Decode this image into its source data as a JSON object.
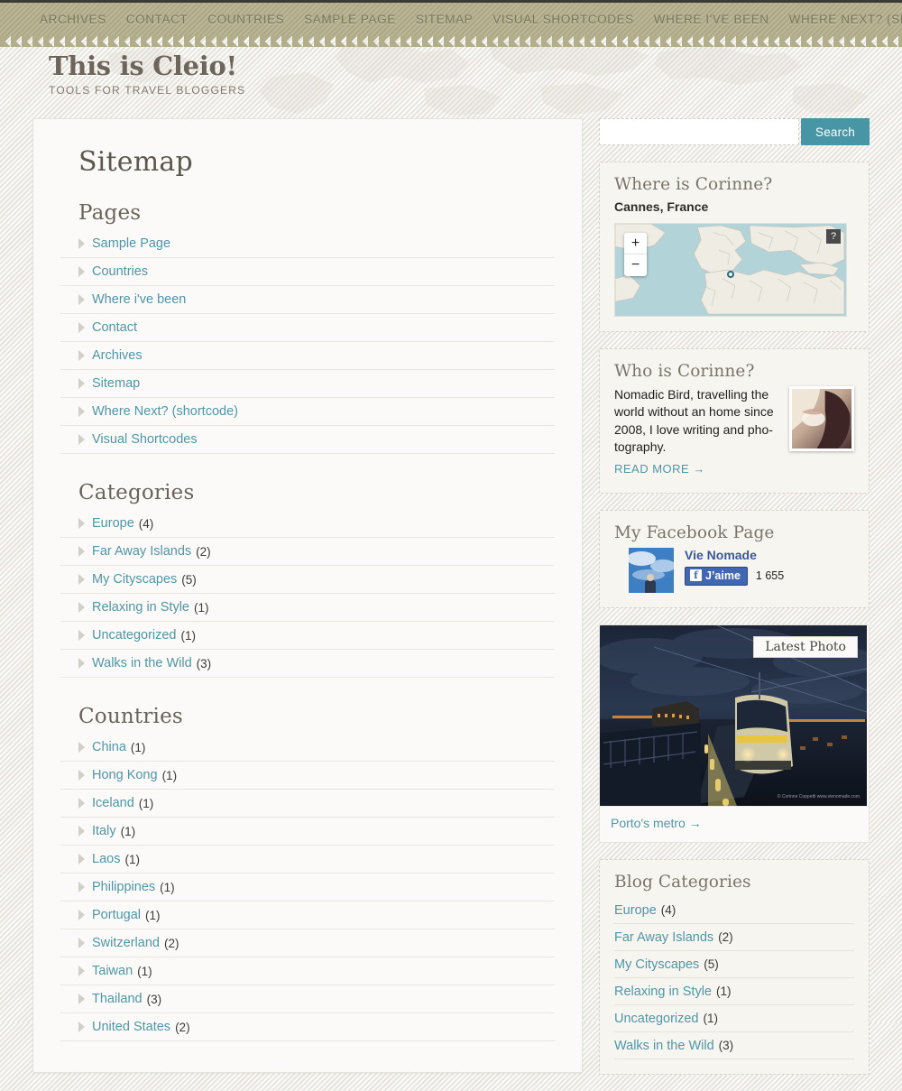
{
  "nav": {
    "items": [
      {
        "label": "ARCHIVES"
      },
      {
        "label": "CONTACT"
      },
      {
        "label": "COUNTRIES"
      },
      {
        "label": "SAMPLE PAGE"
      },
      {
        "label": "SITEMAP"
      },
      {
        "label": "VISUAL SHORTCODES"
      },
      {
        "label": "WHERE I'VE BEEN"
      },
      {
        "label": "WHERE NEXT? (SHORTCODE)"
      }
    ]
  },
  "brand": {
    "title": "This is Cleio!",
    "tagline": "TOOLS FOR TRAVEL BLOGGERS"
  },
  "main": {
    "page_title": "Sitemap",
    "sections": [
      {
        "heading": "Pages",
        "items": [
          {
            "label": "Sample Page",
            "count": ""
          },
          {
            "label": "Countries",
            "count": ""
          },
          {
            "label": "Where i've been",
            "count": ""
          },
          {
            "label": "Contact",
            "count": ""
          },
          {
            "label": "Archives",
            "count": ""
          },
          {
            "label": "Sitemap",
            "count": ""
          },
          {
            "label": "Where Next? (shortcode)",
            "count": ""
          },
          {
            "label": "Visual Shortcodes",
            "count": ""
          }
        ]
      },
      {
        "heading": "Categories",
        "items": [
          {
            "label": "Europe",
            "count": "(4)"
          },
          {
            "label": "Far Away Islands",
            "count": "(2)"
          },
          {
            "label": "My Cityscapes",
            "count": "(5)"
          },
          {
            "label": "Relaxing in Style",
            "count": "(1)"
          },
          {
            "label": "Uncategorized",
            "count": "(1)"
          },
          {
            "label": "Walks in the Wild",
            "count": "(3)"
          }
        ]
      },
      {
        "heading": "Countries",
        "items": [
          {
            "label": "China",
            "count": "(1)"
          },
          {
            "label": "Hong Kong",
            "count": "(1)"
          },
          {
            "label": "Iceland",
            "count": "(1)"
          },
          {
            "label": "Italy",
            "count": "(1)"
          },
          {
            "label": "Laos",
            "count": "(1)"
          },
          {
            "label": "Philippines",
            "count": "(1)"
          },
          {
            "label": "Portugal",
            "count": "(1)"
          },
          {
            "label": "Switzerland",
            "count": "(2)"
          },
          {
            "label": "Taiwan",
            "count": "(1)"
          },
          {
            "label": "Thailand",
            "count": "(3)"
          },
          {
            "label": "United States",
            "count": "(2)"
          }
        ]
      }
    ]
  },
  "sidebar": {
    "search": {
      "value": "",
      "placeholder": "",
      "button_label": "Search"
    },
    "where_widget": {
      "title": "Where is Corinne?",
      "location": "Cannes, France",
      "zoom_in": "+",
      "zoom_out": "−",
      "help": "?"
    },
    "who_widget": {
      "title": "Who is Corinne?",
      "body": "Nomadic Bird, travelling the world without an home since 2008, I love writing and pho-tography.",
      "read_more": "READ MORE →"
    },
    "facebook_widget": {
      "title": "My Facebook Page",
      "page_name": "Vie Nomade",
      "like_label": "J’aime",
      "like_icon": "f",
      "like_count": "1 655"
    },
    "photo_widget": {
      "badge": "Latest Photo",
      "caption": "Porto's metro →",
      "credit": "© Corinne Coppetti\nwww.vienomade.com"
    },
    "blog_categories": {
      "title": "Blog Categories",
      "items": [
        {
          "label": "Europe",
          "count": "(4)"
        },
        {
          "label": "Far Away Islands",
          "count": "(2)"
        },
        {
          "label": "My Cityscapes",
          "count": "(5)"
        },
        {
          "label": "Relaxing in Style",
          "count": "(1)"
        },
        {
          "label": "Uncategorized",
          "count": "(1)"
        },
        {
          "label": "Walks in the Wild",
          "count": "(3)"
        }
      ]
    }
  },
  "colors": {
    "nav_bg": "#b2ae8a",
    "accent_teal": "#4f96a6",
    "search_btn": "#4795a5",
    "heading": "#6a635b",
    "facebook_blue": "#3b5998"
  }
}
